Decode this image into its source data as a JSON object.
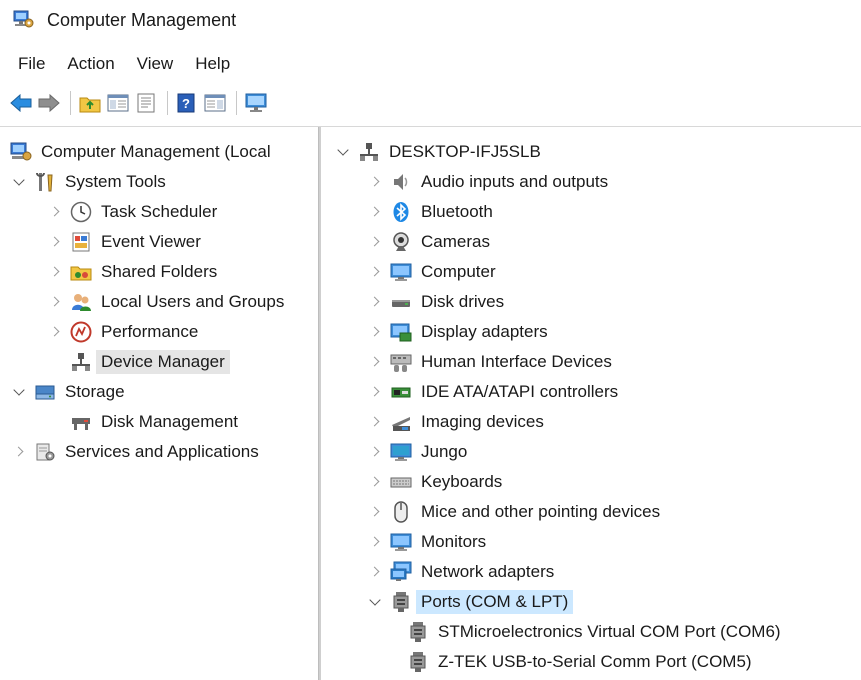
{
  "window": {
    "title": "Computer Management"
  },
  "menu": {
    "items": [
      "File",
      "Action",
      "View",
      "Help"
    ]
  },
  "toolbar": {
    "buttons": [
      "back-icon",
      "forward-icon",
      "up-folder-icon",
      "show-hide-tree-icon",
      "properties-icon",
      "help-icon",
      "action-pane-icon",
      "monitor-icon"
    ]
  },
  "tree": {
    "root": "Computer Management (Local",
    "system_tools": "System Tools",
    "task_scheduler": "Task Scheduler",
    "event_viewer": "Event Viewer",
    "shared_folders": "Shared Folders",
    "local_users": "Local Users and Groups",
    "performance": "Performance",
    "device_manager": "Device Manager",
    "storage": "Storage",
    "disk_management": "Disk Management",
    "services": "Services and Applications"
  },
  "devices": {
    "computer_name": "DESKTOP-IFJ5SLB",
    "categories": [
      "Audio inputs and outputs",
      "Bluetooth",
      "Cameras",
      "Computer",
      "Disk drives",
      "Display adapters",
      "Human Interface Devices",
      "IDE ATA/ATAPI controllers",
      "Imaging devices",
      "Jungo",
      "Keyboards",
      "Mice and other pointing devices",
      "Monitors",
      "Network adapters",
      "Ports (COM & LPT)"
    ],
    "ports": [
      "STMicroelectronics Virtual COM Port (COM6)",
      "Z-TEK USB-to-Serial Comm Port (COM5)"
    ]
  },
  "colors": {
    "selection_gray": "#e5e5e5",
    "selection_blue": "#cce8ff",
    "accent_blue": "#1e88e5"
  }
}
